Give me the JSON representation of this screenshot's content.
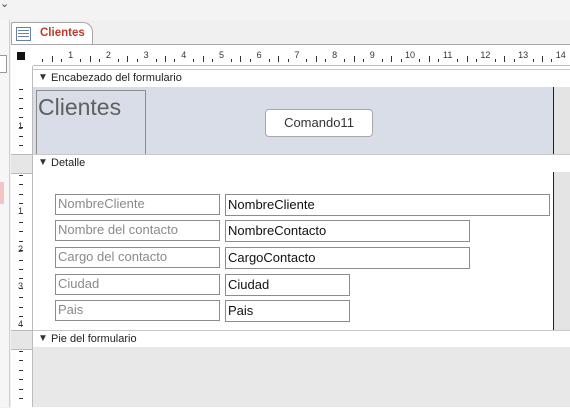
{
  "tab": {
    "label": "Clientes"
  },
  "sections": {
    "header": "Encabezado del formulario",
    "detail": "Detalle",
    "footer": "Pie del formulario"
  },
  "header": {
    "title": "Clientes",
    "command_button": "Comando11"
  },
  "fields": [
    {
      "label": "NombreCliente",
      "value": "NombreCliente"
    },
    {
      "label": "Nombre del contacto",
      "value": "NombreContacto"
    },
    {
      "label": "Cargo del contacto",
      "value": "CargoContacto"
    },
    {
      "label": "Ciudad",
      "value": "Ciudad"
    },
    {
      "label": "Pais",
      "value": "Pais"
    }
  ],
  "rulers": {
    "horizontal": [
      "1",
      "2",
      "3",
      "4",
      "5",
      "6",
      "7",
      "8",
      "9",
      "10",
      "11",
      "12",
      "13",
      "14"
    ],
    "vertical_header": [
      "1"
    ],
    "vertical_detail": [
      "1",
      "2",
      "3",
      "4"
    ]
  },
  "icons": {
    "top_chevron": "chevron-down-icon",
    "tab_icon": "form-icon",
    "section_arrow": "section-collapse-icon"
  }
}
